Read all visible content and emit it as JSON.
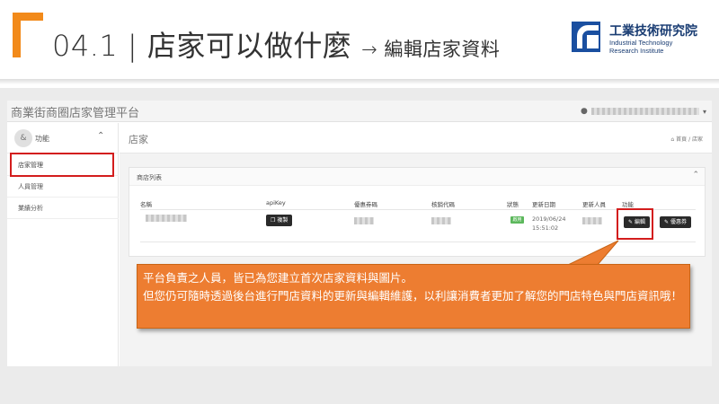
{
  "slide": {
    "title": "04.1 | 店家可以做什麼",
    "subtitle": "→ 編輯店家資料",
    "logo_cn": "工業技術研究院",
    "logo_en_line1": "Industrial Technology",
    "logo_en_line2": "Research Institute",
    "accent_color": "#f28a1a"
  },
  "app": {
    "title": "商業街商圈店家管理平台",
    "user_icon": "user-icon"
  },
  "sidebar": {
    "section_label": "功能",
    "items": [
      {
        "label": "店家管理"
      },
      {
        "label": "人員管理"
      },
      {
        "label": "業績分析"
      }
    ]
  },
  "content": {
    "page_title": "店家",
    "breadcrumb": "首頁 / 店家"
  },
  "panel": {
    "title": "商店列表",
    "columns": [
      "名稱",
      "apiKey",
      "優惠券碼",
      "核銷代碼",
      "狀態",
      "更新日期",
      "更新人員",
      "功能"
    ],
    "row": {
      "copy_button": "複製",
      "status": "啟用",
      "updated_date": "2019/06/24",
      "updated_time": "15:51:02",
      "edit_button": "編輯",
      "coupon_button": "優惠券"
    }
  },
  "callout": {
    "line1": "平台負責之人員，皆已為您建立首次店家資料與圖片。",
    "line2": "但您仍可隨時透過後台進行門店資料的更新與編輯維護，以利讓消費者更加了解您的門店特色與門店資訊哦！",
    "color": "#ed7d31"
  }
}
